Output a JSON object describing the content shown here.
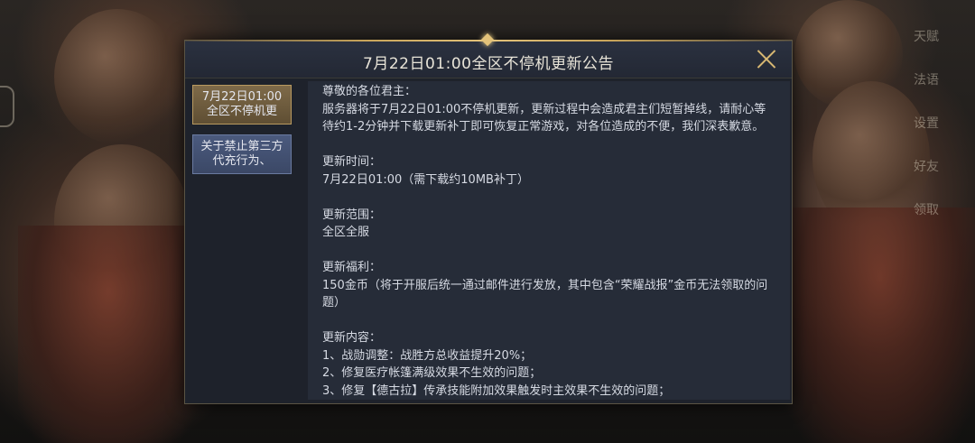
{
  "background": {
    "side_menu": [
      "天赋",
      "法语",
      "设置",
      "好友",
      "领取"
    ]
  },
  "dialog": {
    "title": "7月22日01:00全区不停机更新公告",
    "tabs": [
      {
        "label": "7月22日01:00全区不停机更",
        "active": true
      },
      {
        "label": "关于禁止第三方代充行为、",
        "active": false
      }
    ],
    "content": {
      "greeting": "尊敬的各位君主：",
      "intro": "服务器将于7月22日01:00不停机更新，更新过程中会造成君主们短暂掉线，请耐心等待约1-2分钟并下载更新补丁即可恢复正常游戏，对各位造成的不便，我们深表歉意。",
      "time_heading": "更新时间：",
      "time_value": "7月22日01:00（需下载约10MB补丁）",
      "scope_heading": "更新范围：",
      "scope_value": "全区全服",
      "benefit_heading": "更新福利：",
      "benefit_value": "150金币（将于开服后统一通过邮件进行发放，其中包含“荣耀战报”金币无法领取的问题）",
      "changes_heading": "更新内容：",
      "changes": [
        "1、战勋调整：战胜方总收益提升20%；",
        "2、修复医疗帐篷满级效果不生效的问题；",
        "3、修复【德古拉】传承技能附加效果触发时主效果不生效的问题；"
      ]
    }
  },
  "colors": {
    "accent_gold": "#d8b872",
    "dialog_bg": "#1e222b",
    "tab_active": "#7e6a49",
    "tab_inactive": "#4b5a7e"
  },
  "icons": {
    "close": "close-icon"
  }
}
